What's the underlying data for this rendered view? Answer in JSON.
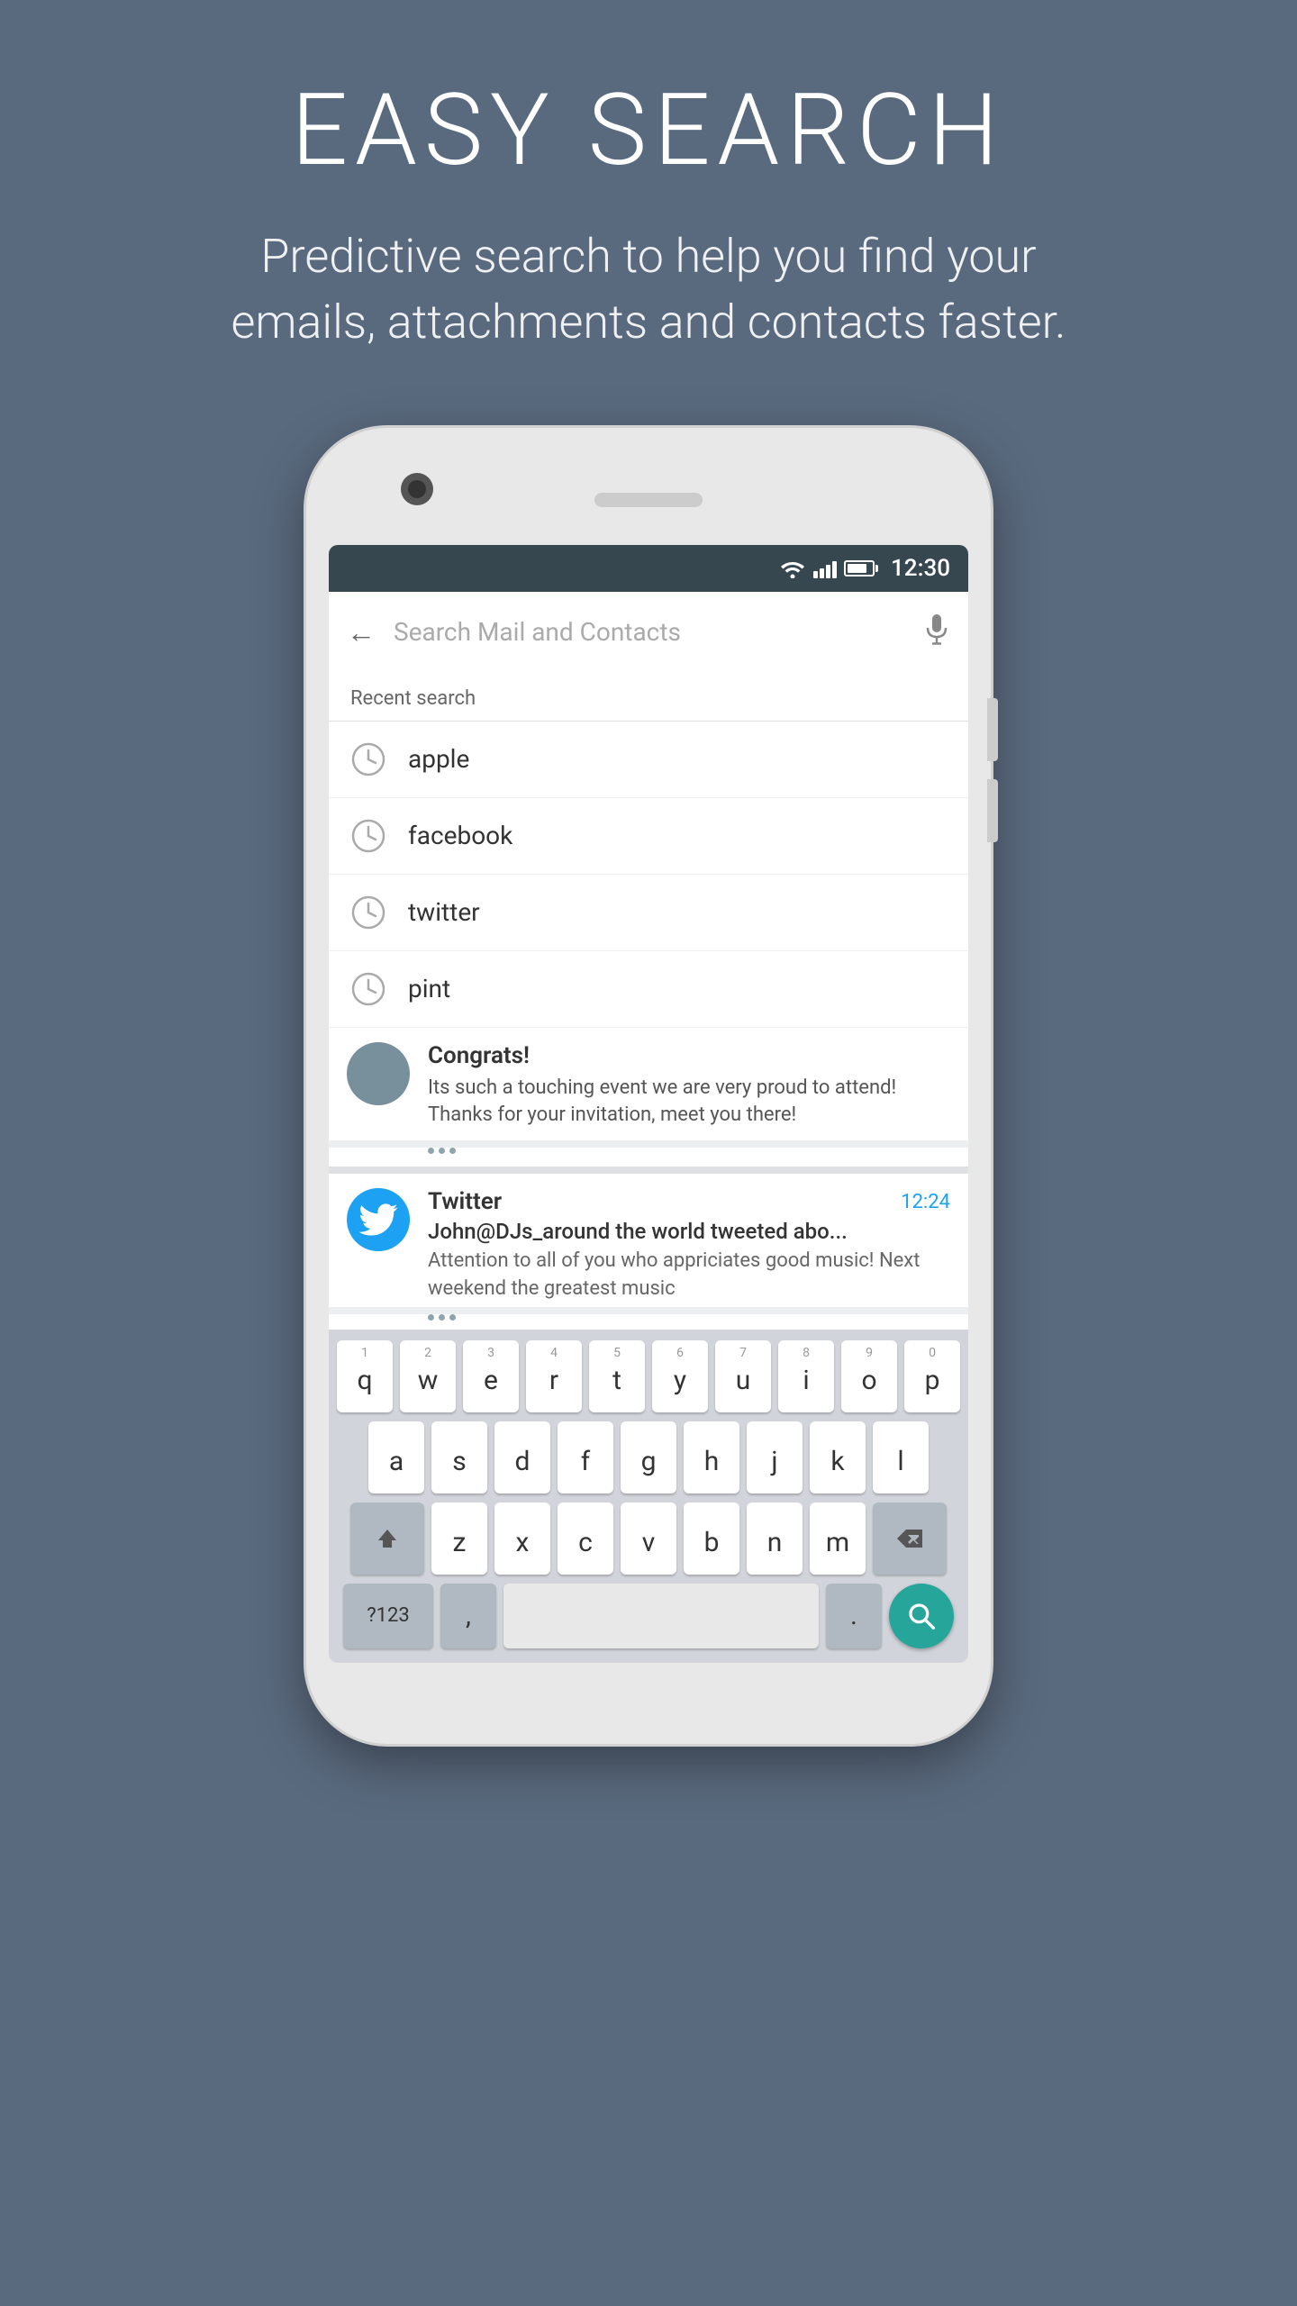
{
  "header": {
    "title": "EASY SEARCH",
    "subtitle": "Predictive search to help you find your emails, attachments and contacts faster."
  },
  "status_bar": {
    "time": "12:30"
  },
  "search_bar": {
    "placeholder": "Search Mail and Contacts"
  },
  "recent_search": {
    "label": "Recent search",
    "items": [
      {
        "text": "apple"
      },
      {
        "text": "facebook"
      },
      {
        "text": "twitter"
      },
      {
        "text": "pint"
      }
    ]
  },
  "emails": [
    {
      "sender": "Twitter",
      "time": "12:24",
      "subject": "John@DJs_around the world tweeted abo...",
      "preview": "Attention to all of you who appriciates good music! Next weekend the greatest music"
    }
  ],
  "partial_email": {
    "preview": "Its such a touching event we are very proud to attend! Thanks for your invitation, meet you there!",
    "subject": "Congrats!"
  },
  "keyboard": {
    "rows": [
      [
        "q",
        "w",
        "e",
        "r",
        "t",
        "y",
        "u",
        "i",
        "o",
        "p"
      ],
      [
        "a",
        "s",
        "d",
        "f",
        "g",
        "h",
        "j",
        "k",
        "l"
      ],
      [
        "z",
        "x",
        "c",
        "v",
        "b",
        "n",
        "m"
      ]
    ],
    "numbers": [
      "1",
      "2",
      "3",
      "4",
      "5",
      "6",
      "7",
      "8",
      "9",
      "0"
    ],
    "special_keys": {
      "numbers_label": "?123",
      "comma": ",",
      "period": "."
    }
  },
  "colors": {
    "background": "#5a6a7e",
    "status_bar": "#37474f",
    "twitter_blue": "#1da1f2",
    "teal": "#26a69a"
  }
}
